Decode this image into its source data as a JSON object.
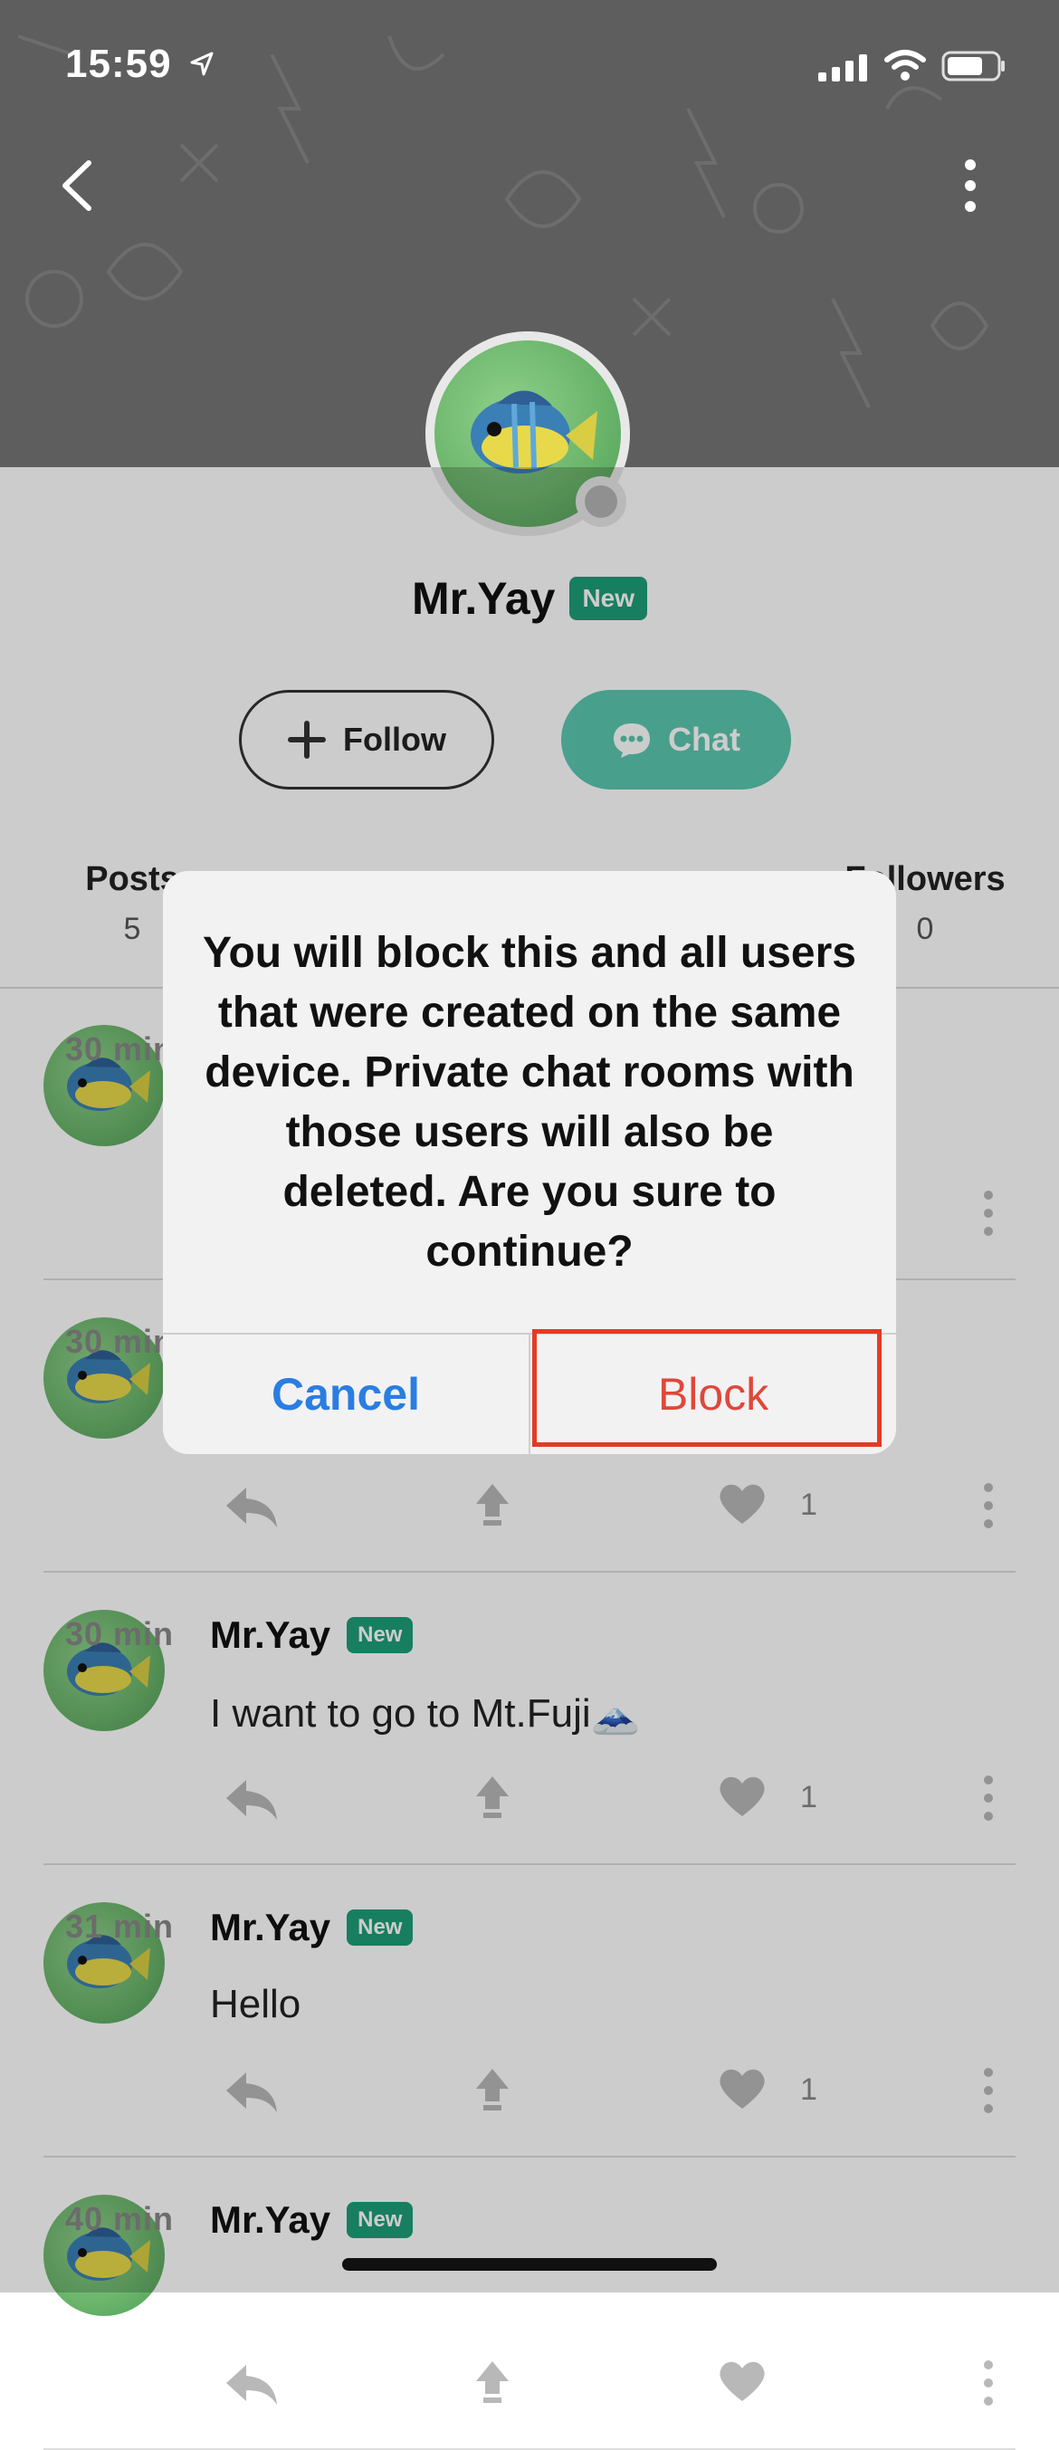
{
  "status_bar": {
    "time": "15:59"
  },
  "profile": {
    "name": "Mr.Yay",
    "badge": "New",
    "follow_label": "Follow",
    "chat_label": "Chat"
  },
  "stats": [
    {
      "label": "Posts",
      "value": "5"
    },
    {
      "label": "Followers",
      "value": "0"
    }
  ],
  "posts": [
    {
      "name": "Mr.Yay",
      "badge": "New",
      "time": "30 min",
      "text": "",
      "likes": ""
    },
    {
      "name": "Mr.Yay",
      "badge": "New",
      "time": "30 min",
      "text": "",
      "likes": "1"
    },
    {
      "name": "Mr.Yay",
      "badge": "New",
      "time": "30 min",
      "text": "I want to go to Mt.Fuji🗻",
      "likes": "1"
    },
    {
      "name": "Mr.Yay",
      "badge": "New",
      "time": "31 min",
      "text": "Hello",
      "likes": "1"
    },
    {
      "name": "Mr.Yay",
      "badge": "New",
      "time": "40 min",
      "text": "",
      "likes": ""
    }
  ],
  "alert": {
    "message": "You will block this and all users that were created on the same device. Private chat rooms with those users will also be deleted. Are you sure to continue?",
    "cancel_label": "Cancel",
    "block_label": "Block"
  },
  "colors": {
    "accent_green": "#1e9e78",
    "chat_teal": "#3fbea3",
    "cancel_blue": "#2a7de1",
    "block_red": "#e0473b",
    "highlight_red": "#e33b24"
  }
}
